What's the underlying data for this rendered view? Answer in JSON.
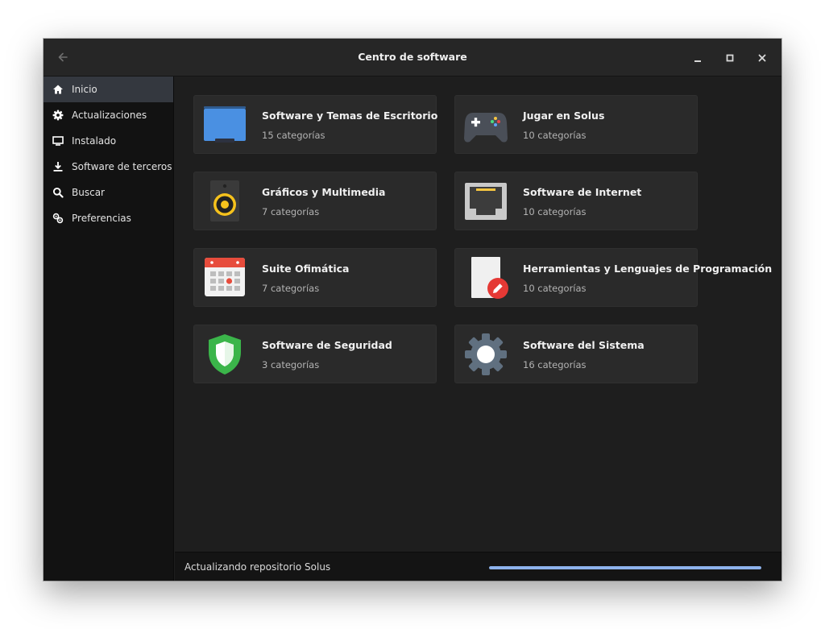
{
  "window": {
    "title": "Centro de software"
  },
  "sidebar": {
    "items": [
      {
        "label": "Inicio",
        "icon": "home-icon",
        "active": true
      },
      {
        "label": "Actualizaciones",
        "icon": "gear-icon",
        "active": false
      },
      {
        "label": "Instalado",
        "icon": "monitor-icon",
        "active": false
      },
      {
        "label": "Software de terceros",
        "icon": "download-icon",
        "active": false
      },
      {
        "label": "Buscar",
        "icon": "search-icon",
        "active": false
      },
      {
        "label": "Preferencias",
        "icon": "preferences-icon",
        "active": false
      }
    ]
  },
  "categories": [
    {
      "title": "Software y Temas de Escritorio",
      "subtitle": "15 categorías",
      "icon": "desktop-folder-icon"
    },
    {
      "title": "Jugar en Solus",
      "subtitle": "10 categorías",
      "icon": "gamepad-icon"
    },
    {
      "title": "Gráficos y Multimedia",
      "subtitle": "7 categorías",
      "icon": "speaker-icon"
    },
    {
      "title": "Software de Internet",
      "subtitle": "10 categorías",
      "icon": "network-port-icon"
    },
    {
      "title": "Suite Ofimática",
      "subtitle": "7 categorías",
      "icon": "calendar-icon"
    },
    {
      "title": "Herramientas y Lenguajes de Programación",
      "subtitle": "10 categorías",
      "icon": "document-edit-icon"
    },
    {
      "title": "Software de Seguridad",
      "subtitle": "3 categorías",
      "icon": "shield-icon"
    },
    {
      "title": "Software del Sistema",
      "subtitle": "16 categorías",
      "icon": "system-gear-icon"
    }
  ],
  "status": {
    "text": "Actualizando repositorio Solus",
    "progress": 1.0
  },
  "colors": {
    "accent": "#8db2ec",
    "sidebar_active": "#34383f",
    "card_bg": "#2a2a2a"
  }
}
